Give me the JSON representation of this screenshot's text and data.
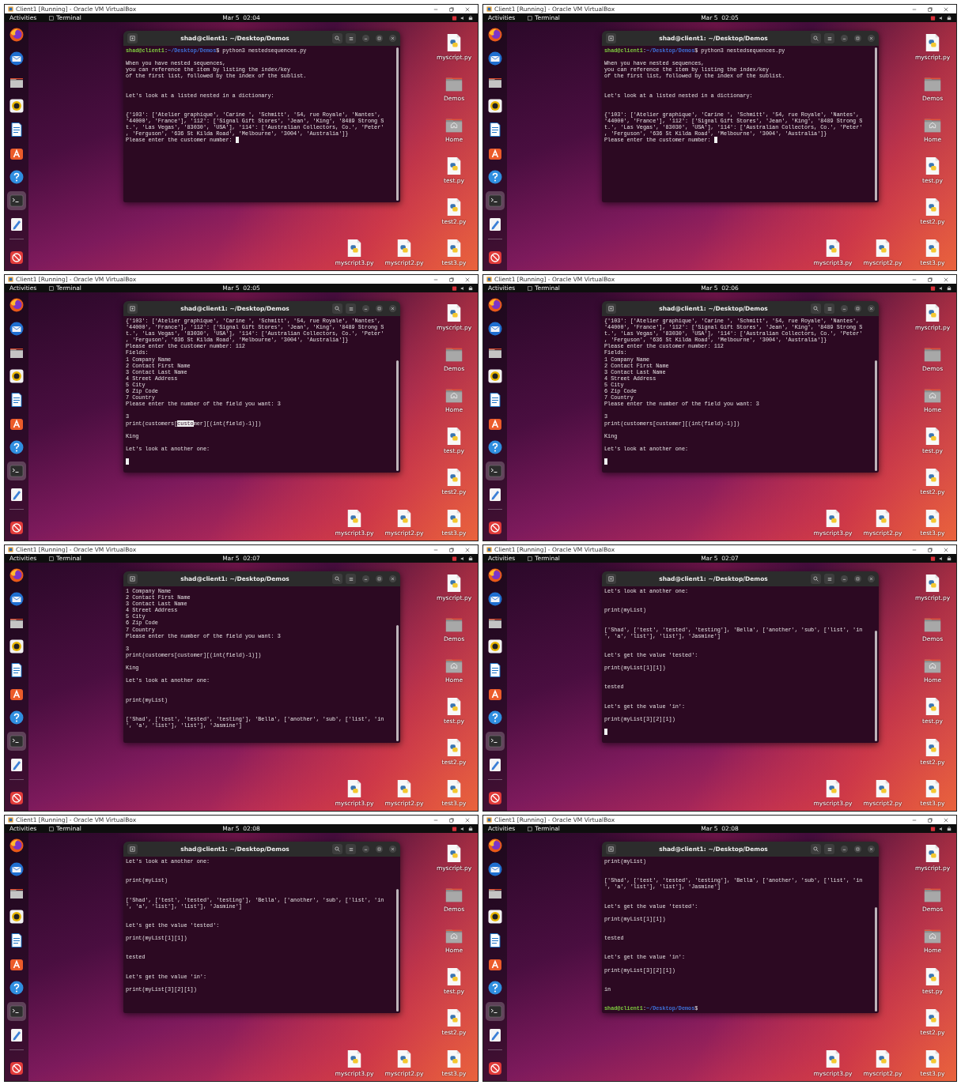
{
  "panels": [
    {
      "window_title": "Client1 [Running] - Oracle VM VirtualBox",
      "activities": "Activities",
      "app_name": "Terminal",
      "clock": "Mar 5  02:04",
      "dock": [
        {
          "active": false
        },
        {
          "active": false
        },
        {
          "active": false
        },
        {
          "active": false
        },
        {
          "active": false
        },
        {
          "active": false
        },
        {
          "active": false
        },
        {
          "active": true
        },
        {
          "active": false
        },
        {
          "active": false
        }
      ],
      "desktop_column": [
        {
          "label": "myscript.py",
          "kind": "python"
        },
        {
          "label": "Demos",
          "kind": "folder"
        },
        {
          "label": "Home",
          "kind": "home"
        },
        {
          "label": "test.py",
          "kind": "python"
        },
        {
          "label": "test2.py",
          "kind": "python"
        },
        {
          "label": "test3.py",
          "kind": "python"
        }
      ],
      "desktop_row": [
        {
          "label": "myscript3.py",
          "kind": "python"
        },
        {
          "label": "myscript2.py",
          "kind": "python"
        }
      ],
      "terminal": {
        "title": "shad@client1: ~/Desktop/Demos",
        "lines": [
          {
            "kind": "prompt",
            "user": "shad@client1",
            "colon": ":",
            "path": "~/Desktop/Demos",
            "sign": "$",
            "command": "python3 nestedsequences.py"
          },
          {
            "kind": "blank"
          },
          {
            "kind": "text",
            "text": "When you have nested sequences,"
          },
          {
            "kind": "text",
            "text": "you can reference the item by listing the index/key"
          },
          {
            "kind": "text",
            "text": "of the first list, followed by the index of the sublist."
          },
          {
            "kind": "blank"
          },
          {
            "kind": "blank"
          },
          {
            "kind": "text",
            "text": "Let's look at a listed nested in a dictionary:"
          },
          {
            "kind": "blank"
          },
          {
            "kind": "blank"
          },
          {
            "kind": "text",
            "text": "{'103': ['Atelier graphique', 'Carine ', 'Schmitt', '54, rue Royale', 'Nantes',"
          },
          {
            "kind": "text",
            "text": "'44000', 'France'], '112': ['Signal Gift Stores', 'Jean', 'King', '8489 Strong S"
          },
          {
            "kind": "text",
            "text": "t.', 'Las Vegas', '83030', 'USA'], '114': ['Australian Collectors, Co.', 'Peter'"
          },
          {
            "kind": "text",
            "text": ", 'Ferguson', '636 St Kilda Road', 'Melbourne', '3004', 'Australia']}"
          },
          {
            "kind": "text",
            "text": "Please enter the customer number:",
            "cursor": true
          }
        ]
      }
    },
    {
      "window_title": "Client1 [Running] - Oracle VM VirtualBox",
      "activities": "Activities",
      "app_name": "Terminal",
      "clock": "Mar 5  02:05",
      "dock": [
        {
          "active": false
        },
        {
          "active": false
        },
        {
          "active": false
        },
        {
          "active": false
        },
        {
          "active": false
        },
        {
          "active": false
        },
        {
          "active": false
        },
        {
          "active": true
        },
        {
          "active": false
        },
        {
          "active": false
        }
      ],
      "desktop_column": [
        {
          "label": "myscript.py",
          "kind": "python"
        },
        {
          "label": "Demos",
          "kind": "folder"
        },
        {
          "label": "Home",
          "kind": "home"
        },
        {
          "label": "test.py",
          "kind": "python"
        },
        {
          "label": "test2.py",
          "kind": "python"
        },
        {
          "label": "test3.py",
          "kind": "python"
        }
      ],
      "desktop_row": [
        {
          "label": "myscript3.py",
          "kind": "python"
        },
        {
          "label": "myscript2.py",
          "kind": "python"
        }
      ],
      "terminal": {
        "title": "shad@client1: ~/Desktop/Demos",
        "lines": [
          {
            "kind": "prompt",
            "user": "shad@client1",
            "colon": ":",
            "path": "~/Desktop/Demos",
            "sign": "$",
            "command": "python3 nestedsequences.py"
          },
          {
            "kind": "blank"
          },
          {
            "kind": "text",
            "text": "When you have nested sequences,"
          },
          {
            "kind": "text",
            "text": "you can reference the item by listing the index/key"
          },
          {
            "kind": "text",
            "text": "of the first list, followed by the index of the sublist."
          },
          {
            "kind": "blank"
          },
          {
            "kind": "blank"
          },
          {
            "kind": "text",
            "text": "Let's look at a listed nested in a dictionary:"
          },
          {
            "kind": "blank"
          },
          {
            "kind": "blank"
          },
          {
            "kind": "text",
            "text": "{'103': ['Atelier graphique', 'Carine ', 'Schmitt', '54, rue Royale', 'Nantes',"
          },
          {
            "kind": "text",
            "text": "'44000', 'France'], '112': ['Signal Gift Stores', 'Jean', 'King', '8489 Strong S"
          },
          {
            "kind": "text",
            "text": "t.', 'Las Vegas', '83030', 'USA'], '114': ['Australian Collectors, Co.', 'Peter'"
          },
          {
            "kind": "text",
            "text": ", 'Ferguson', '636 St Kilda Road', 'Melbourne', '3004', 'Australia']}"
          },
          {
            "kind": "text",
            "text": "Please enter the customer number:",
            "cursor": true
          }
        ]
      }
    },
    {
      "window_title": "Client1 [Running] - Oracle VM VirtualBox",
      "activities": "Activities",
      "app_name": "Terminal",
      "clock": "Mar 5  02:05",
      "dock": [
        {
          "active": false
        },
        {
          "active": false
        },
        {
          "active": false
        },
        {
          "active": false
        },
        {
          "active": false
        },
        {
          "active": false
        },
        {
          "active": false
        },
        {
          "active": true
        },
        {
          "active": false
        },
        {
          "active": false
        }
      ],
      "desktop_column": [
        {
          "label": "myscript.py",
          "kind": "python"
        },
        {
          "label": "Demos",
          "kind": "folder"
        },
        {
          "label": "Home",
          "kind": "home"
        },
        {
          "label": "test.py",
          "kind": "python"
        },
        {
          "label": "test2.py",
          "kind": "python"
        },
        {
          "label": "test3.py",
          "kind": "python"
        }
      ],
      "desktop_row": [
        {
          "label": "myscript3.py",
          "kind": "python"
        },
        {
          "label": "myscript2.py",
          "kind": "python"
        }
      ],
      "terminal": {
        "title": "shad@client1: ~/Desktop/Demos",
        "lines": [
          {
            "kind": "text",
            "text": "{'103': ['Atelier graphique', 'Carine ', 'Schmitt', '54, rue Royale', 'Nantes',"
          },
          {
            "kind": "text",
            "text": "'44000', 'France'], '112': ['Signal Gift Stores', 'Jean', 'King', '8489 Strong S"
          },
          {
            "kind": "text",
            "text": "t.', 'Las Vegas', '83030', 'USA'], '114': ['Australian Collectors, Co.', 'Peter'"
          },
          {
            "kind": "text",
            "text": ", 'Ferguson', '636 St Kilda Road', 'Melbourne', '3004', 'Australia']}"
          },
          {
            "kind": "text",
            "text": "Please enter the customer number: 112"
          },
          {
            "kind": "text",
            "text": "Fields:"
          },
          {
            "kind": "text",
            "text": "1 Company Name"
          },
          {
            "kind": "text",
            "text": "2 Contact First Name"
          },
          {
            "kind": "text",
            "text": "3 Contact Last Name"
          },
          {
            "kind": "text",
            "text": "4 Street Address"
          },
          {
            "kind": "text",
            "text": "5 City"
          },
          {
            "kind": "text",
            "text": "6 Zip Code"
          },
          {
            "kind": "text",
            "text": "7 Country"
          },
          {
            "kind": "text",
            "text": "Please enter the number of the field you want: 3"
          },
          {
            "kind": "blank"
          },
          {
            "kind": "text",
            "text": "3"
          },
          {
            "kind": "segments",
            "segments": [
              {
                "text": "print(customers[",
                "selected": false
              },
              {
                "text": "custo",
                "selected": true
              },
              {
                "text": "mer][(int(field)-1)])",
                "selected": false
              }
            ]
          },
          {
            "kind": "blank"
          },
          {
            "kind": "text",
            "text": "King"
          },
          {
            "kind": "blank"
          },
          {
            "kind": "text",
            "text": "Let's look at another one:"
          },
          {
            "kind": "blank"
          },
          {
            "kind": "text",
            "cursor": true
          }
        ]
      }
    },
    {
      "window_title": "Client1 [Running] - Oracle VM VirtualBox",
      "activities": "Activities",
      "app_name": "Terminal",
      "clock": "Mar 5  02:06",
      "dock": [
        {
          "active": false
        },
        {
          "active": false
        },
        {
          "active": false
        },
        {
          "active": false
        },
        {
          "active": false
        },
        {
          "active": false
        },
        {
          "active": false
        },
        {
          "active": true
        },
        {
          "active": false
        },
        {
          "active": false
        }
      ],
      "desktop_column": [
        {
          "label": "myscript.py",
          "kind": "python"
        },
        {
          "label": "Demos",
          "kind": "folder"
        },
        {
          "label": "Home",
          "kind": "home"
        },
        {
          "label": "test.py",
          "kind": "python"
        },
        {
          "label": "test2.py",
          "kind": "python"
        },
        {
          "label": "test3.py",
          "kind": "python"
        }
      ],
      "desktop_row": [
        {
          "label": "myscript3.py",
          "kind": "python"
        },
        {
          "label": "myscript2.py",
          "kind": "python"
        }
      ],
      "terminal": {
        "title": "shad@client1: ~/Desktop/Demos",
        "lines": [
          {
            "kind": "text",
            "text": "{'103': ['Atelier graphique', 'Carine ', 'Schmitt', '54, rue Royale', 'Nantes',"
          },
          {
            "kind": "text",
            "text": "'44000', 'France'], '112': ['Signal Gift Stores', 'Jean', 'King', '8489 Strong S"
          },
          {
            "kind": "text",
            "text": "t.', 'Las Vegas', '83030', 'USA'], '114': ['Australian Collectors, Co.', 'Peter'"
          },
          {
            "kind": "text",
            "text": ", 'Ferguson', '636 St Kilda Road', 'Melbourne', '3004', 'Australia']}"
          },
          {
            "kind": "text",
            "text": "Please enter the customer number: 112"
          },
          {
            "kind": "text",
            "text": "Fields:"
          },
          {
            "kind": "text",
            "text": "1 Company Name"
          },
          {
            "kind": "text",
            "text": "2 Contact First Name"
          },
          {
            "kind": "text",
            "text": "3 Contact Last Name"
          },
          {
            "kind": "text",
            "text": "4 Street Address"
          },
          {
            "kind": "text",
            "text": "5 City"
          },
          {
            "kind": "text",
            "text": "6 Zip Code"
          },
          {
            "kind": "text",
            "text": "7 Country"
          },
          {
            "kind": "text",
            "text": "Please enter the number of the field you want: 3"
          },
          {
            "kind": "blank"
          },
          {
            "kind": "text",
            "text": "3"
          },
          {
            "kind": "text",
            "text": "print(customers[customer][(int(field)-1)])"
          },
          {
            "kind": "blank"
          },
          {
            "kind": "text",
            "text": "King"
          },
          {
            "kind": "blank"
          },
          {
            "kind": "text",
            "text": "Let's look at another one:"
          },
          {
            "kind": "blank"
          },
          {
            "kind": "text",
            "cursor": true
          }
        ]
      }
    },
    {
      "window_title": "Client1 [Running] - Oracle VM VirtualBox",
      "activities": "Activities",
      "app_name": "Terminal",
      "clock": "Mar 5  02:07",
      "dock": [
        {
          "active": false
        },
        {
          "active": false
        },
        {
          "active": false
        },
        {
          "active": false
        },
        {
          "active": false
        },
        {
          "active": false
        },
        {
          "active": false
        },
        {
          "active": true
        },
        {
          "active": false
        },
        {
          "active": false
        }
      ],
      "desktop_column": [
        {
          "label": "myscript.py",
          "kind": "python"
        },
        {
          "label": "Demos",
          "kind": "folder"
        },
        {
          "label": "Home",
          "kind": "home"
        },
        {
          "label": "test.py",
          "kind": "python"
        },
        {
          "label": "test2.py",
          "kind": "python"
        },
        {
          "label": "test3.py",
          "kind": "python"
        }
      ],
      "desktop_row": [
        {
          "label": "myscript3.py",
          "kind": "python"
        },
        {
          "label": "myscript2.py",
          "kind": "python"
        }
      ],
      "terminal": {
        "title": "shad@client1: ~/Desktop/Demos",
        "lines": [
          {
            "kind": "text",
            "text": "1 Company Name"
          },
          {
            "kind": "text",
            "text": "2 Contact First Name"
          },
          {
            "kind": "text",
            "text": "3 Contact Last Name"
          },
          {
            "kind": "text",
            "text": "4 Street Address"
          },
          {
            "kind": "text",
            "text": "5 City"
          },
          {
            "kind": "text",
            "text": "6 Zip Code"
          },
          {
            "kind": "text",
            "text": "7 Country"
          },
          {
            "kind": "text",
            "text": "Please enter the number of the field you want: 3"
          },
          {
            "kind": "blank"
          },
          {
            "kind": "text",
            "text": "3"
          },
          {
            "kind": "text",
            "text": "print(customers[customer][(int(field)-1)])"
          },
          {
            "kind": "blank"
          },
          {
            "kind": "text",
            "text": "King"
          },
          {
            "kind": "blank"
          },
          {
            "kind": "text",
            "text": "Let's look at another one:"
          },
          {
            "kind": "blank"
          },
          {
            "kind": "blank"
          },
          {
            "kind": "text",
            "text": "print(myList)"
          },
          {
            "kind": "blank"
          },
          {
            "kind": "blank"
          },
          {
            "kind": "text",
            "text": "['Shad', ['test', 'tested', 'testing'], 'Bella', ['another', 'sub', ['list', 'in"
          },
          {
            "kind": "text",
            "text": "', 'a', 'list'], 'list'], 'Jasmine']"
          }
        ]
      }
    },
    {
      "window_title": "Client1 [Running] - Oracle VM VirtualBox",
      "activities": "Activities",
      "app_name": "Terminal",
      "clock": "Mar 5  02:07",
      "dock": [
        {
          "active": false
        },
        {
          "active": false
        },
        {
          "active": false
        },
        {
          "active": false
        },
        {
          "active": false
        },
        {
          "active": false
        },
        {
          "active": false
        },
        {
          "active": true
        },
        {
          "active": false
        },
        {
          "active": false
        }
      ],
      "desktop_column": [
        {
          "label": "myscript.py",
          "kind": "python"
        },
        {
          "label": "Demos",
          "kind": "folder"
        },
        {
          "label": "Home",
          "kind": "home"
        },
        {
          "label": "test.py",
          "kind": "python"
        },
        {
          "label": "test2.py",
          "kind": "python"
        },
        {
          "label": "test3.py",
          "kind": "python"
        }
      ],
      "desktop_row": [
        {
          "label": "myscript3.py",
          "kind": "python"
        },
        {
          "label": "myscript2.py",
          "kind": "python"
        }
      ],
      "terminal": {
        "title": "shad@client1: ~/Desktop/Demos",
        "lines": [
          {
            "kind": "text",
            "text": "Let's look at another one:"
          },
          {
            "kind": "blank"
          },
          {
            "kind": "blank"
          },
          {
            "kind": "text",
            "text": "print(myList)"
          },
          {
            "kind": "blank"
          },
          {
            "kind": "blank"
          },
          {
            "kind": "text",
            "text": "['Shad', ['test', 'tested', 'testing'], 'Bella', ['another', 'sub', ['list', 'in"
          },
          {
            "kind": "text",
            "text": "', 'a', 'list'], 'list'], 'Jasmine']"
          },
          {
            "kind": "blank"
          },
          {
            "kind": "blank"
          },
          {
            "kind": "text",
            "text": "Let's get the value 'tested':"
          },
          {
            "kind": "blank"
          },
          {
            "kind": "text",
            "text": "print(myList[1][1])"
          },
          {
            "kind": "blank"
          },
          {
            "kind": "blank"
          },
          {
            "kind": "text",
            "text": "tested"
          },
          {
            "kind": "blank"
          },
          {
            "kind": "blank"
          },
          {
            "kind": "text",
            "text": "Let's get the value 'in':"
          },
          {
            "kind": "blank"
          },
          {
            "kind": "text",
            "text": "print(myList[3][2][1])"
          },
          {
            "kind": "blank"
          },
          {
            "kind": "text",
            "cursor": true
          }
        ]
      }
    },
    {
      "window_title": "Client1 [Running] - Oracle VM VirtualBox",
      "activities": "Activities",
      "app_name": "Terminal",
      "clock": "Mar 5  02:08",
      "dock": [
        {
          "active": false
        },
        {
          "active": false
        },
        {
          "active": false
        },
        {
          "active": false
        },
        {
          "active": false
        },
        {
          "active": false
        },
        {
          "active": false
        },
        {
          "active": true
        },
        {
          "active": false
        },
        {
          "active": false
        }
      ],
      "desktop_column": [
        {
          "label": "myscript.py",
          "kind": "python"
        },
        {
          "label": "Demos",
          "kind": "folder"
        },
        {
          "label": "Home",
          "kind": "home"
        },
        {
          "label": "test.py",
          "kind": "python"
        },
        {
          "label": "test2.py",
          "kind": "python"
        },
        {
          "label": "test3.py",
          "kind": "python"
        }
      ],
      "desktop_row": [
        {
          "label": "myscript3.py",
          "kind": "python"
        },
        {
          "label": "myscript2.py",
          "kind": "python"
        }
      ],
      "terminal": {
        "title": "shad@client1: ~/Desktop/Demos",
        "lines": [
          {
            "kind": "text",
            "text": "Let's look at another one:"
          },
          {
            "kind": "blank"
          },
          {
            "kind": "blank"
          },
          {
            "kind": "text",
            "text": "print(myList)"
          },
          {
            "kind": "blank"
          },
          {
            "kind": "blank"
          },
          {
            "kind": "text",
            "text": "['Shad', ['test', 'tested', 'testing'], 'Bella', ['another', 'sub', ['list', 'in"
          },
          {
            "kind": "text",
            "text": "', 'a', 'list'], 'list'], 'Jasmine']"
          },
          {
            "kind": "blank"
          },
          {
            "kind": "blank"
          },
          {
            "kind": "text",
            "text": "Let's get the value 'tested':"
          },
          {
            "kind": "blank"
          },
          {
            "kind": "text",
            "text": "print(myList[1][1])"
          },
          {
            "kind": "blank"
          },
          {
            "kind": "blank"
          },
          {
            "kind": "text",
            "text": "tested"
          },
          {
            "kind": "blank"
          },
          {
            "kind": "blank"
          },
          {
            "kind": "text",
            "text": "Let's get the value 'in':"
          },
          {
            "kind": "blank"
          },
          {
            "kind": "text",
            "text": "print(myList[3][2][1])"
          }
        ]
      }
    },
    {
      "window_title": "Client1 [Running] - Oracle VM VirtualBox",
      "activities": "Activities",
      "app_name": "Terminal",
      "clock": "Mar 5  02:08",
      "dock": [
        {
          "active": false
        },
        {
          "active": false
        },
        {
          "active": false
        },
        {
          "active": false
        },
        {
          "active": false
        },
        {
          "active": false
        },
        {
          "active": false
        },
        {
          "active": true
        },
        {
          "active": false
        },
        {
          "active": false
        }
      ],
      "desktop_column": [
        {
          "label": "myscript.py",
          "kind": "python"
        },
        {
          "label": "Demos",
          "kind": "folder"
        },
        {
          "label": "Home",
          "kind": "home"
        },
        {
          "label": "test.py",
          "kind": "python"
        },
        {
          "label": "test2.py",
          "kind": "python"
        },
        {
          "label": "test3.py",
          "kind": "python"
        }
      ],
      "desktop_row": [
        {
          "label": "myscript3.py",
          "kind": "python"
        },
        {
          "label": "myscript2.py",
          "kind": "python"
        }
      ],
      "terminal": {
        "title": "shad@client1: ~/Desktop/Demos",
        "lines": [
          {
            "kind": "text",
            "text": "print(myList)"
          },
          {
            "kind": "blank"
          },
          {
            "kind": "blank"
          },
          {
            "kind": "text",
            "text": "['Shad', ['test', 'tested', 'testing'], 'Bella', ['another', 'sub', ['list', 'in"
          },
          {
            "kind": "text",
            "text": "', 'a', 'list'], 'list'], 'Jasmine']"
          },
          {
            "kind": "blank"
          },
          {
            "kind": "blank"
          },
          {
            "kind": "text",
            "text": "Let's get the value 'tested':"
          },
          {
            "kind": "blank"
          },
          {
            "kind": "text",
            "text": "print(myList[1][1])"
          },
          {
            "kind": "blank"
          },
          {
            "kind": "blank"
          },
          {
            "kind": "text",
            "text": "tested"
          },
          {
            "kind": "blank"
          },
          {
            "kind": "blank"
          },
          {
            "kind": "text",
            "text": "Let's get the value 'in':"
          },
          {
            "kind": "blank"
          },
          {
            "kind": "text",
            "text": "print(myList[3][2][1])"
          },
          {
            "kind": "blank"
          },
          {
            "kind": "blank"
          },
          {
            "kind": "text",
            "text": "in"
          },
          {
            "kind": "blank"
          },
          {
            "kind": "blank"
          },
          {
            "kind": "prompt",
            "user": "shad@client1",
            "colon": ":",
            "path": "~/Desktop/Demos",
            "sign": "$"
          }
        ]
      }
    }
  ]
}
